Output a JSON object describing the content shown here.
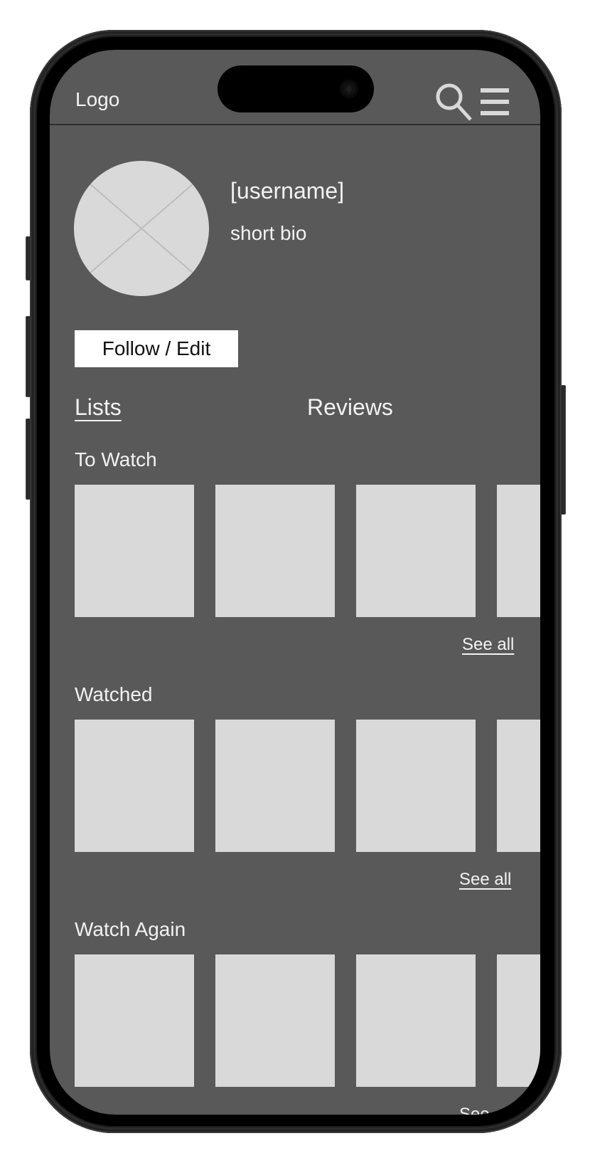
{
  "header": {
    "logo": "Logo",
    "search_icon": "search-icon",
    "menu_icon": "hamburger-menu-icon"
  },
  "profile": {
    "avatar_icon": "image-placeholder-icon",
    "username": "[username]",
    "bio": "short bio",
    "follow_button": "Follow / Edit"
  },
  "tabs": [
    {
      "label": "Lists",
      "active": true
    },
    {
      "label": "Reviews",
      "active": false
    }
  ],
  "sections": [
    {
      "title": "To Watch",
      "see_all": "See all",
      "card_count": 4
    },
    {
      "title": "Watched",
      "see_all": "See all",
      "card_count": 4
    },
    {
      "title": "Watch Again",
      "see_all": "See all",
      "card_count": 4
    }
  ],
  "colors": {
    "screen_bg": "#595959",
    "placeholder": "#d9d9d9",
    "text": "#f2f2f2",
    "button_bg": "#ffffff"
  }
}
